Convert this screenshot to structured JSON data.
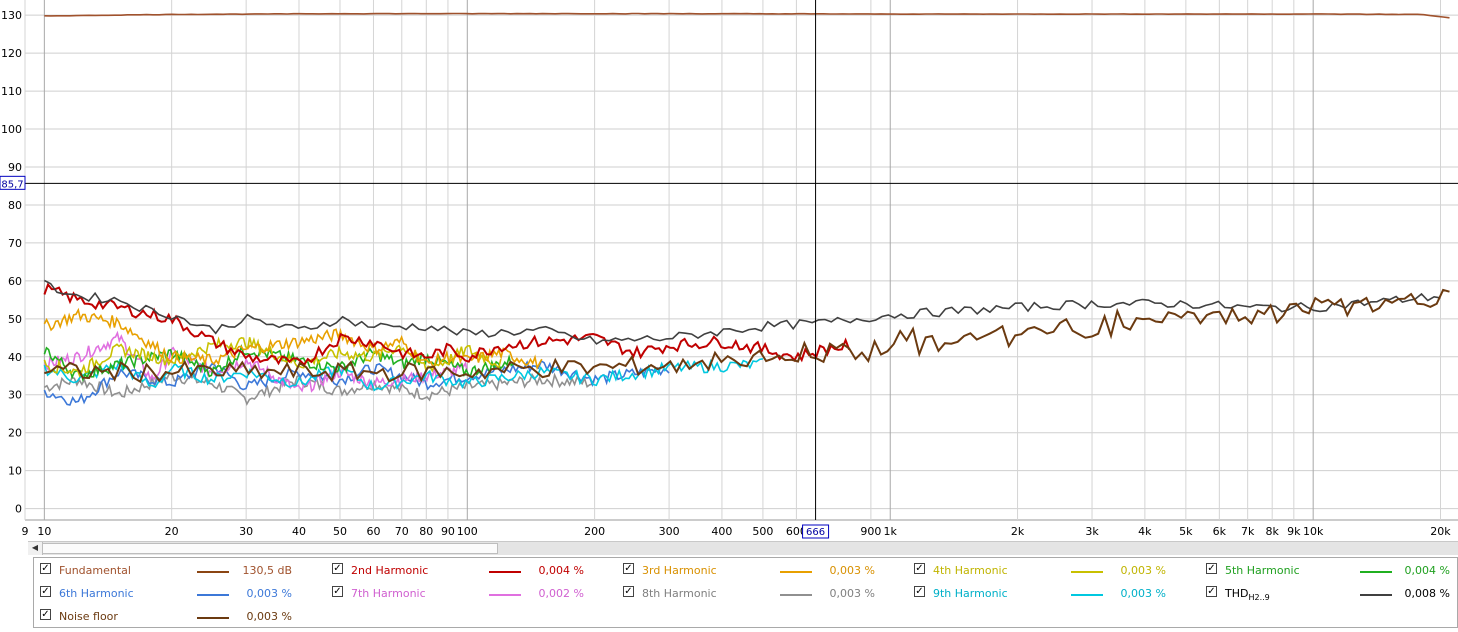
{
  "chart_data": {
    "type": "line",
    "x_scale": "log",
    "xlim": [
      9,
      22000
    ],
    "ylim": [
      -3,
      134
    ],
    "grid": true,
    "x_ticks": [
      {
        "v": 9,
        "label": "9"
      },
      {
        "v": 10,
        "label": "10"
      },
      {
        "v": 20,
        "label": "20"
      },
      {
        "v": 30,
        "label": "30"
      },
      {
        "v": 40,
        "label": "40"
      },
      {
        "v": 50,
        "label": "50"
      },
      {
        "v": 60,
        "label": "60"
      },
      {
        "v": 70,
        "label": "70"
      },
      {
        "v": 80,
        "label": "80"
      },
      {
        "v": 90,
        "label": "90"
      },
      {
        "v": 100,
        "label": "100"
      },
      {
        "v": 200,
        "label": "200"
      },
      {
        "v": 300,
        "label": "300"
      },
      {
        "v": 400,
        "label": "400"
      },
      {
        "v": 500,
        "label": "500"
      },
      {
        "v": 600,
        "label": "600"
      },
      {
        "v": 900,
        "label": "900"
      },
      {
        "v": 1000,
        "label": "1k"
      },
      {
        "v": 2000,
        "label": "2k"
      },
      {
        "v": 3000,
        "label": "3k"
      },
      {
        "v": 4000,
        "label": "4k"
      },
      {
        "v": 5000,
        "label": "5k"
      },
      {
        "v": 6000,
        "label": "6k"
      },
      {
        "v": 7000,
        "label": "7k"
      },
      {
        "v": 8000,
        "label": "8k"
      },
      {
        "v": 9000,
        "label": "9k"
      },
      {
        "v": 10000,
        "label": "10k"
      },
      {
        "v": 20000,
        "label": "20k"
      }
    ],
    "y_ticks": [
      0,
      10,
      20,
      30,
      40,
      50,
      60,
      70,
      80,
      90,
      100,
      110,
      120,
      130
    ],
    "cursor": {
      "x": 666,
      "x_label": "666",
      "y": 85.7,
      "y_label": "85,7"
    },
    "series": [
      {
        "name": "Fundamental",
        "color": "#a0522d",
        "freq": [
          10,
          20,
          50,
          100,
          300,
          1000,
          3000,
          10000,
          18000,
          21000
        ],
        "db": [
          129.8,
          130.2,
          130.4,
          130.4,
          130.4,
          130.3,
          130.3,
          130.3,
          130.2,
          129.3
        ]
      },
      {
        "name": "2nd Harmonic",
        "color": "#c00000",
        "freq": [
          10,
          12,
          15,
          18,
          20,
          25,
          30,
          40,
          50,
          60,
          70,
          80,
          90,
          100,
          120,
          150,
          200,
          250,
          300,
          400,
          500,
          600,
          700,
          800
        ],
        "db": [
          58,
          55,
          53,
          51,
          50,
          44,
          40,
          38,
          45,
          44,
          41,
          40,
          42,
          40,
          43,
          44,
          45,
          41,
          43,
          44,
          42,
          40,
          42,
          43
        ]
      },
      {
        "name": "3rd Harmonic",
        "color": "#e8a000",
        "freq": [
          10,
          12,
          15,
          18,
          20,
          25,
          30,
          40,
          50,
          60,
          70,
          80,
          90,
          100,
          120,
          150
        ],
        "db": [
          48,
          51,
          49,
          43,
          40,
          39,
          42,
          44,
          46,
          42,
          44,
          38,
          40,
          39,
          41,
          38
        ]
      },
      {
        "name": "4th Harmonic",
        "color": "#c8c000",
        "freq": [
          10,
          12,
          15,
          20,
          25,
          30,
          40,
          50,
          60,
          70,
          80,
          90,
          100,
          120
        ],
        "db": [
          38,
          36,
          42,
          39,
          43,
          44,
          38,
          41,
          40,
          43,
          37,
          39,
          42,
          38
        ]
      },
      {
        "name": "5th Harmonic",
        "color": "#20b020",
        "freq": [
          10,
          12,
          15,
          20,
          25,
          30,
          40,
          50,
          60,
          70,
          80,
          100,
          130
        ],
        "db": [
          42,
          35,
          38,
          41,
          36,
          42,
          39,
          37,
          41,
          38,
          40,
          36,
          39
        ]
      },
      {
        "name": "6th Harmonic",
        "color": "#3c78d8",
        "freq": [
          10,
          12,
          15,
          20,
          25,
          30,
          40,
          50,
          60,
          80,
          100,
          150,
          200,
          300
        ],
        "db": [
          31,
          28,
          36,
          33,
          38,
          32,
          36,
          34,
          37,
          33,
          35,
          38,
          34,
          37
        ]
      },
      {
        "name": "7th Harmonic",
        "color": "#e070e0",
        "freq": [
          10,
          12,
          15,
          18,
          20,
          25,
          30,
          40,
          50,
          60,
          80,
          100
        ],
        "db": [
          38,
          40,
          45,
          34,
          41,
          36,
          39,
          31,
          36,
          33,
          35,
          37
        ]
      },
      {
        "name": "8th Harmonic",
        "color": "#909090",
        "freq": [
          10,
          12,
          15,
          20,
          25,
          30,
          40,
          50,
          60,
          80,
          100,
          150,
          200
        ],
        "db": [
          32,
          34,
          30,
          35,
          33,
          29,
          34,
          31,
          33,
          30,
          32,
          34,
          33
        ]
      },
      {
        "name": "9th Harmonic",
        "color": "#00c8e0",
        "freq": [
          10,
          12,
          15,
          18,
          20,
          25,
          30,
          40,
          50,
          60,
          80,
          100,
          150,
          200,
          300,
          500
        ],
        "db": [
          37,
          34,
          38,
          32,
          37,
          34,
          36,
          33,
          37,
          32,
          35,
          33,
          36,
          34,
          37,
          38
        ]
      },
      {
        "name": "THD",
        "color": "#404040",
        "freq": [
          10,
          12,
          15,
          18,
          20,
          25,
          30,
          40,
          50,
          60,
          80,
          100,
          150,
          200,
          300,
          500,
          700,
          1000,
          2000,
          3000,
          5000,
          7000,
          10000,
          20000
        ],
        "db": [
          59,
          56,
          55,
          52,
          51,
          47,
          50,
          47,
          50,
          48,
          48,
          46,
          47,
          44,
          45,
          48,
          49,
          51,
          53,
          54,
          54,
          53,
          53,
          56
        ]
      },
      {
        "name": "Noise floor",
        "color": "#6b3a10",
        "freq": [
          10,
          20,
          50,
          100,
          150,
          200,
          300,
          500,
          700,
          1000,
          2000,
          3000,
          5000,
          7000,
          10000,
          15000,
          20000,
          21000
        ],
        "db": [
          36,
          36,
          36,
          36,
          37,
          37,
          38,
          39,
          41,
          43,
          46,
          48,
          50,
          51,
          53,
          54,
          55,
          55
        ]
      }
    ]
  },
  "legend": [
    {
      "name": "Fundamental",
      "color": "#a0522d",
      "line_color": "#8b4513",
      "value": "130,5 dB",
      "checked": "✓"
    },
    {
      "name": "2nd Harmonic",
      "color": "#c00000",
      "line_color": "#c00000",
      "value": "0,004 %",
      "checked": "✓"
    },
    {
      "name": "3rd Harmonic",
      "color": "#d89000",
      "line_color": "#e8a000",
      "value": "0,003 %",
      "checked": "✓"
    },
    {
      "name": "4th Harmonic",
      "color": "#c0b400",
      "line_color": "#c8c000",
      "value": "0,003 %",
      "checked": "✓"
    },
    {
      "name": "5th Harmonic",
      "color": "#20a020",
      "line_color": "#20b020",
      "value": "0,004 %",
      "checked": "✓"
    },
    {
      "name": "6th Harmonic",
      "color": "#3c78d8",
      "line_color": "#3c78d8",
      "value": "0,003 %",
      "checked": "✓"
    },
    {
      "name": "7th Harmonic",
      "color": "#d060d0",
      "line_color": "#e070e0",
      "value": "0,002 %",
      "checked": "✓"
    },
    {
      "name": "8th Harmonic",
      "color": "#808080",
      "line_color": "#909090",
      "value": "0,003 %",
      "checked": "✓"
    },
    {
      "name": "9th Harmonic",
      "color": "#00b0c8",
      "line_color": "#00c8e0",
      "value": "0,003 %",
      "checked": "✓"
    },
    {
      "name": "THD",
      "sub": "H2..9",
      "color": "#000000",
      "line_color": "#404040",
      "value": "0,008 %",
      "checked": "✓"
    },
    {
      "name": "Noise floor",
      "color": "#6b3a10",
      "line_color": "#6b3a10",
      "value": "0,003 %",
      "checked": "✓"
    }
  ],
  "scrollbar": {
    "left_arrow": "◀"
  }
}
